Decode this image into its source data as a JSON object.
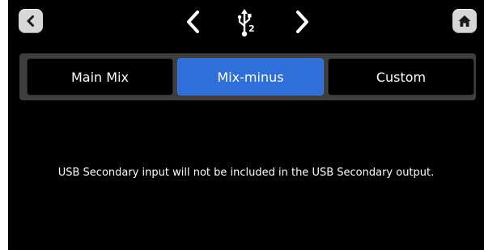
{
  "header": {
    "back_icon": "chevron-left-icon",
    "prev_icon": "chevron-left-icon",
    "usb_icon": "usb-icon",
    "usb_port_number": "2",
    "next_icon": "chevron-right-icon",
    "home_icon": "home-icon"
  },
  "tabs": [
    {
      "label": "Main Mix",
      "selected": false
    },
    {
      "label": "Mix-minus",
      "selected": true
    },
    {
      "label": "Custom",
      "selected": false
    }
  ],
  "colors": {
    "selected_tab": "#2f6fd9",
    "background": "#000000",
    "tab_bar": "#3e3e3e"
  },
  "message": "USB Secondary input will not be included in the USB Secondary output."
}
